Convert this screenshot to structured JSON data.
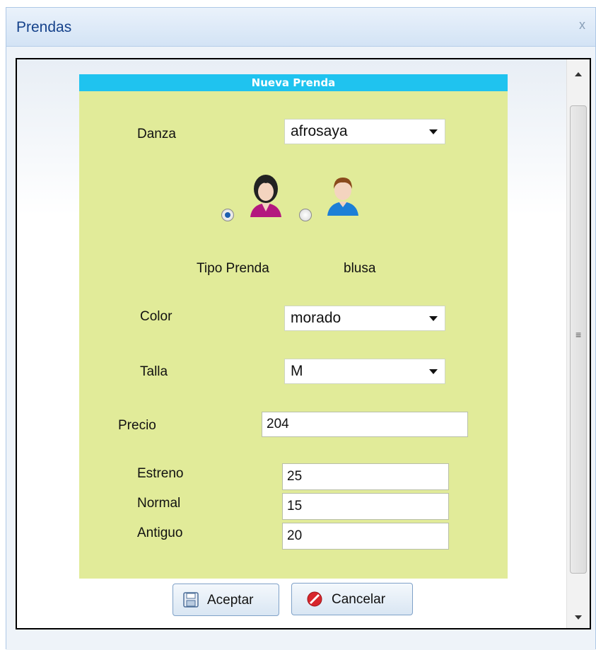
{
  "window": {
    "title": "Prendas",
    "close_glyph": "x"
  },
  "panel": {
    "header": "Nueva Prenda"
  },
  "danza": {
    "label": "Danza",
    "value": "afrosaya"
  },
  "gender": {
    "options": [
      {
        "icon": "female-user-icon",
        "selected": true
      },
      {
        "icon": "male-user-icon",
        "selected": false
      }
    ]
  },
  "tipo_prenda": {
    "label": "Tipo Prenda",
    "value": "blusa"
  },
  "color": {
    "label": "Color",
    "value": "morado"
  },
  "talla": {
    "label": "Talla",
    "value": "M"
  },
  "precio": {
    "label": "Precio",
    "value": "204"
  },
  "estreno": {
    "label": "Estreno",
    "value": "25"
  },
  "normal": {
    "label": "Normal",
    "value": "15"
  },
  "antiguo": {
    "label": "Antiguo",
    "value": "20"
  },
  "buttons": {
    "accept": "Aceptar",
    "cancel": "Cancelar"
  },
  "colors": {
    "panel_bg": "#e1eb99",
    "header_bg": "#1fc3ef",
    "title_text": "#15428b"
  }
}
